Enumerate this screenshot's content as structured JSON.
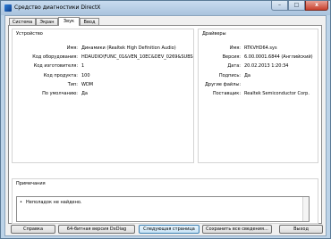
{
  "window": {
    "title": "Средство диагностики DirectX"
  },
  "title_buttons": {
    "minimize": "–",
    "maximize": "□",
    "close": "x"
  },
  "tabs": [
    {
      "label": "Система"
    },
    {
      "label": "Экран"
    },
    {
      "label": "Звук"
    },
    {
      "label": "Ввод"
    }
  ],
  "device": {
    "title": "Устройство",
    "fields": [
      {
        "label": "Имя:",
        "value": "Динамики (Realtek High Definition Audio)"
      },
      {
        "label": "Код оборудования:",
        "value": "HDAUDIO\\FUNC_01&VEN_10EC&DEV_0269&SUBS"
      },
      {
        "label": "Код изготовителя:",
        "value": "1"
      },
      {
        "label": "Код продукта:",
        "value": "100"
      },
      {
        "label": "Тип:",
        "value": "WDM"
      },
      {
        "label": "По умолчанию:",
        "value": "Да"
      }
    ]
  },
  "drivers": {
    "title": "Драйверы",
    "fields": [
      {
        "label": "Имя:",
        "value": "RTKVHD64.sys"
      },
      {
        "label": "Версия:",
        "value": "6.00.0001.6844 (Английский)"
      },
      {
        "label": "Дата:",
        "value": "20.02.2013 1:20:34"
      },
      {
        "label": "Подпись:",
        "value": "Да"
      },
      {
        "label": "Другие файлы:",
        "value": ""
      },
      {
        "label": "Поставщик:",
        "value": "Realtek Semiconductor Corp."
      }
    ]
  },
  "notes": {
    "title": "Примечания",
    "lines": [
      "Неполадок не найдено."
    ]
  },
  "buttons": {
    "help": "Справка",
    "x64": "64-битная версия DxDiag",
    "next": "Следующая страница",
    "save": "Сохранить все сведения...",
    "exit": "Выход"
  },
  "colors": {
    "accent": "#3c7fb1",
    "titlebar": "#bcd3e8",
    "close": "#c8402c"
  }
}
